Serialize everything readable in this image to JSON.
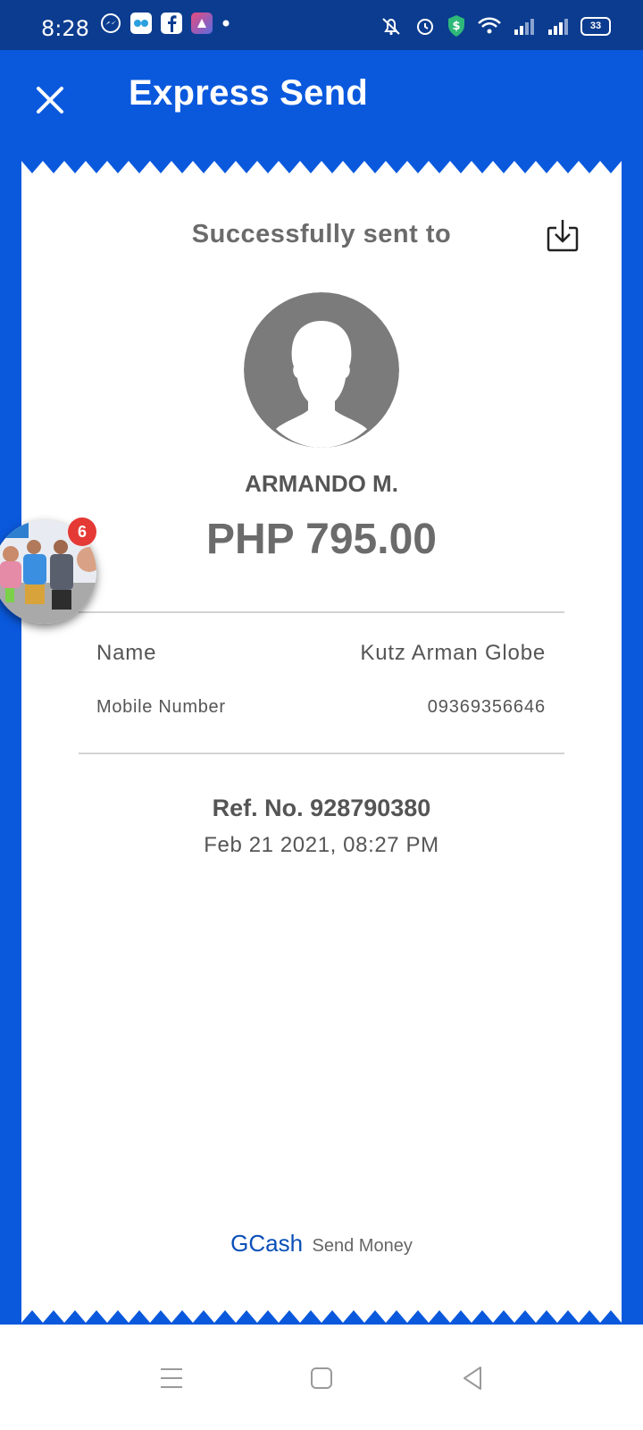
{
  "status_bar": {
    "time": "8:28",
    "battery": "33",
    "left_icons": [
      "messenger-icon",
      "app-owl-icon",
      "facebook-icon",
      "app-icon",
      "dot-icon"
    ],
    "right_icons": [
      "mute-icon",
      "alarm-icon",
      "shield-dollar-icon",
      "wifi-icon",
      "signal-icon",
      "signal-icon",
      "battery-icon"
    ]
  },
  "header": {
    "title": "Express Send",
    "close_icon": "close-icon"
  },
  "receipt": {
    "success_label": "Successfully sent to",
    "download_icon": "download-icon",
    "recipient_name": "ARMANDO M.",
    "amount": "PHP 795.00",
    "details": {
      "name_label": "Name",
      "name_value": "Kutz Arman Globe",
      "mobile_label": "Mobile Number",
      "mobile_value": "09369356646"
    },
    "reference": "Ref. No. 928790380",
    "date": "Feb 21 2021, 08:27 PM",
    "footer_brand": "GCash",
    "footer_text": "Send Money"
  },
  "chat_head": {
    "badge_count": "6"
  },
  "colors": {
    "primary": "#0a59dd",
    "status_bar": "#0b3c8f",
    "text_gray": "#6b6b6b",
    "brand_blue": "#0a4fb8",
    "badge_red": "#e53935"
  },
  "nav_bar": {
    "icons": [
      "menu-icon",
      "home-icon",
      "back-icon"
    ]
  }
}
